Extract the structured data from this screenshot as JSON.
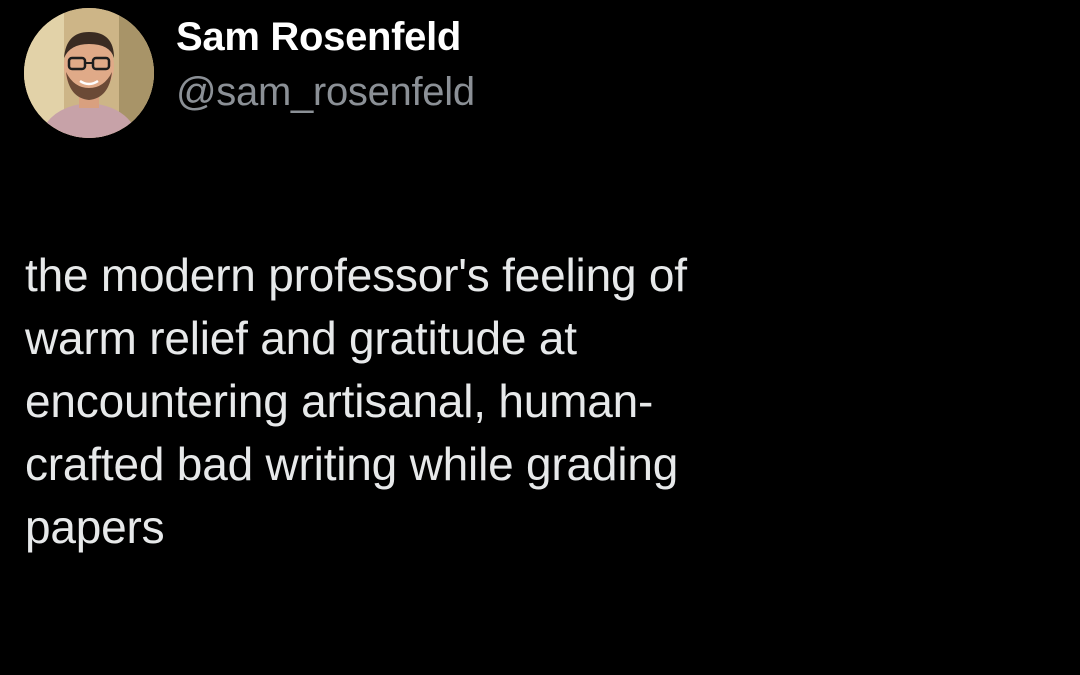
{
  "tweet": {
    "author": {
      "display_name": "Sam Rosenfeld",
      "handle": "@sam_rosenfeld",
      "avatar_icon": "profile-photo"
    },
    "text_lines": [
      "the modern professor's feeling of",
      "warm relief and gratitude at",
      "encountering artisanal, human-",
      "crafted bad writing while grading",
      "papers"
    ]
  },
  "colors": {
    "background": "#000000",
    "name": "#ffffff",
    "handle": "#8b9096",
    "text": "#e7e9ea"
  }
}
